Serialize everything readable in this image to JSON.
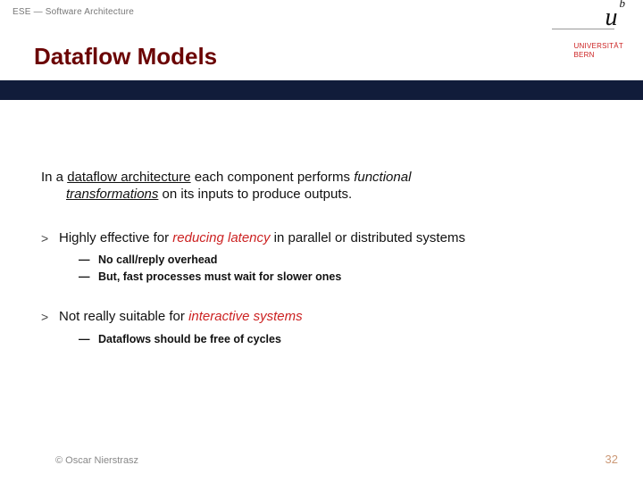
{
  "meta": {
    "breadcrumb": "ESE — Software Architecture"
  },
  "logo": {
    "mark": "u",
    "sup": "b",
    "sub1": "UNIVERSITÄT",
    "sub2": "BERN"
  },
  "title": "Dataflow Models",
  "intro": {
    "pre": "In a ",
    "term": "dataflow architecture",
    "mid": " each component performs ",
    "func": "functional",
    "line2_em": "transformations",
    "line2_rest": " on its inputs to produce outputs."
  },
  "items": [
    {
      "lead": "Highly effective for ",
      "hl": "reducing latency",
      "tail": " in parallel or distributed systems",
      "subs": [
        "No call/reply overhead",
        "But, fast processes must wait for slower ones"
      ]
    },
    {
      "lead": "Not really suitable for ",
      "hl": "interactive systems",
      "tail": "",
      "subs": [
        "Dataflows should be free of cycles"
      ]
    }
  ],
  "footer": {
    "copyright": "© Oscar Nierstrasz",
    "page": "32"
  },
  "glyph": {
    "gt": ">",
    "dash": "—"
  }
}
